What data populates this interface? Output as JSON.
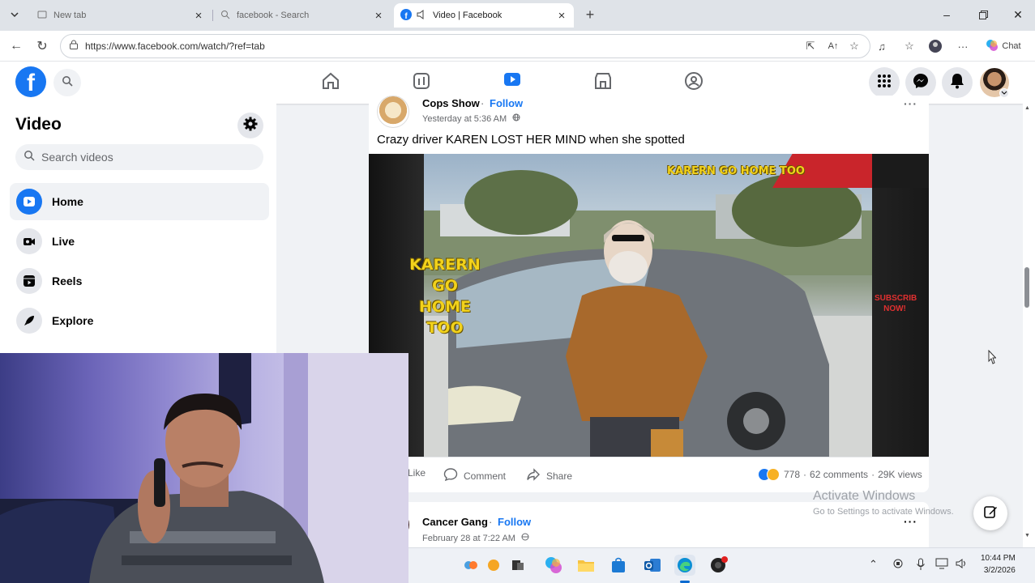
{
  "browser": {
    "tabs": [
      {
        "title": "New tab",
        "active": false,
        "icon": "new-tab-icon"
      },
      {
        "title": "facebook - Search",
        "active": false,
        "icon": "search-icon"
      },
      {
        "title": "Video | Facebook",
        "active": true,
        "icon": "facebook-icon"
      }
    ],
    "url": "https://www.facebook.com/watch/?ref=tab",
    "copilot_label": "Chat"
  },
  "sidebar": {
    "title": "Video",
    "search_placeholder": "Search videos",
    "items": [
      {
        "label": "Home",
        "icon": "play-icon",
        "active": true
      },
      {
        "label": "Live",
        "icon": "live-icon",
        "active": false
      },
      {
        "label": "Reels",
        "icon": "reels-icon",
        "active": false
      },
      {
        "label": "Explore",
        "icon": "rocket-icon",
        "active": false
      }
    ]
  },
  "post": {
    "page_name": "Cops Show",
    "follow_label": "Follow",
    "time": "Yesterday at 5:36 AM",
    "text": "Crazy driver KAREN LOST HER MIND when she spotted",
    "video_overlay_top": "KARERN GO HOME TOO",
    "video_overlay_left": [
      "KARERN",
      "GO",
      "HOME",
      "TOO"
    ],
    "video_side_label": [
      "SUBSCRIB",
      "NOW!"
    ],
    "actions": {
      "like": "Like",
      "comment": "Comment",
      "share": "Share"
    },
    "stats": {
      "reactions": "778",
      "comments": "62 comments",
      "views": "29K views"
    }
  },
  "next_post": {
    "page_name": "Cancer Gang",
    "follow_label": "Follow",
    "time": "February 28 at 7:22 AM"
  },
  "watermark": {
    "line1": "Activate Windows",
    "line2": "Go to Settings to activate Windows."
  },
  "taskbar": {
    "time": "10:44 PM",
    "date": "3/2/2026"
  },
  "colors": {
    "facebook_blue": "#1877f2",
    "page_bg": "#f0f2f5",
    "overlay_yellow": "#f2d21b"
  }
}
